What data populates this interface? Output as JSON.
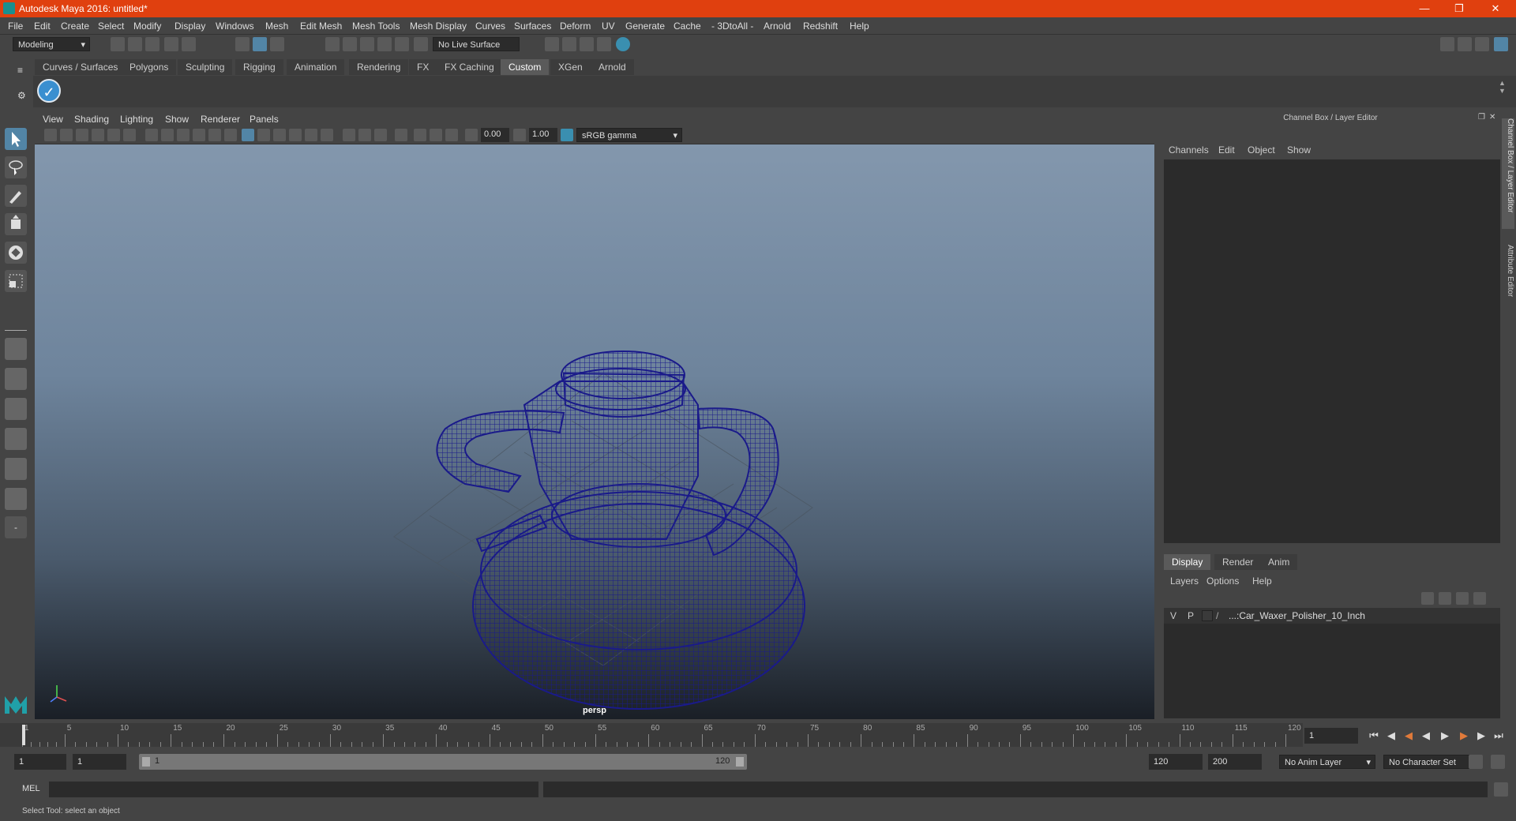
{
  "window": {
    "title": "Autodesk Maya 2016: untitled*"
  },
  "menubar": [
    "File",
    "Edit",
    "Create",
    "Select",
    "Modify",
    "Display",
    "Windows",
    "Mesh",
    "Edit Mesh",
    "Mesh Tools",
    "Mesh Display",
    "Curves",
    "Surfaces",
    "Deform",
    "UV",
    "Generate",
    "Cache",
    "- 3DtoAll -",
    "Arnold",
    "Redshift",
    "Help"
  ],
  "statusline": {
    "mode": "Modeling",
    "live_surface": "No Live Surface"
  },
  "shelf_tabs": [
    "Curves / Surfaces",
    "Polygons",
    "Sculpting",
    "Rigging",
    "Animation",
    "Rendering",
    "FX",
    "FX Caching",
    "Custom",
    "XGen",
    "Arnold"
  ],
  "active_shelf_tab": "Custom",
  "viewport": {
    "menu": [
      "View",
      "Shading",
      "Lighting",
      "Show",
      "Renderer",
      "Panels"
    ],
    "exposure": "0.00",
    "gamma": "1.00",
    "color_space": "sRGB gamma",
    "camera_label": "persp"
  },
  "channel_box": {
    "title": "Channel Box / Layer Editor",
    "menu": [
      "Channels",
      "Edit",
      "Object",
      "Show"
    ],
    "layer_tabs": [
      "Display",
      "Render",
      "Anim"
    ],
    "active_layer_tab": "Display",
    "layer_menu": [
      "Layers",
      "Options",
      "Help"
    ],
    "layers": [
      {
        "v": "V",
        "p": "P",
        "name": "...:Car_Waxer_Polisher_10_Inch"
      }
    ]
  },
  "side_tabs": [
    "Channel Box / Layer Editor",
    "Attribute Editor"
  ],
  "timeline": {
    "ticks": [
      "1",
      "5",
      "10",
      "15",
      "20",
      "25",
      "30",
      "35",
      "40",
      "45",
      "50",
      "55",
      "60",
      "65",
      "70",
      "75",
      "80",
      "85",
      "90",
      "95",
      "100",
      "105",
      "110",
      "115",
      "120"
    ],
    "current_frame": "1"
  },
  "range": {
    "start": "1",
    "start_inner": "1",
    "slider_start": "1",
    "slider_end": "120",
    "end_inner": "120",
    "end": "200",
    "anim_layer": "No Anim Layer",
    "character_set": "No Character Set"
  },
  "cmdline": {
    "label": "MEL"
  },
  "helpline": {
    "text": "Select Tool: select an object"
  }
}
